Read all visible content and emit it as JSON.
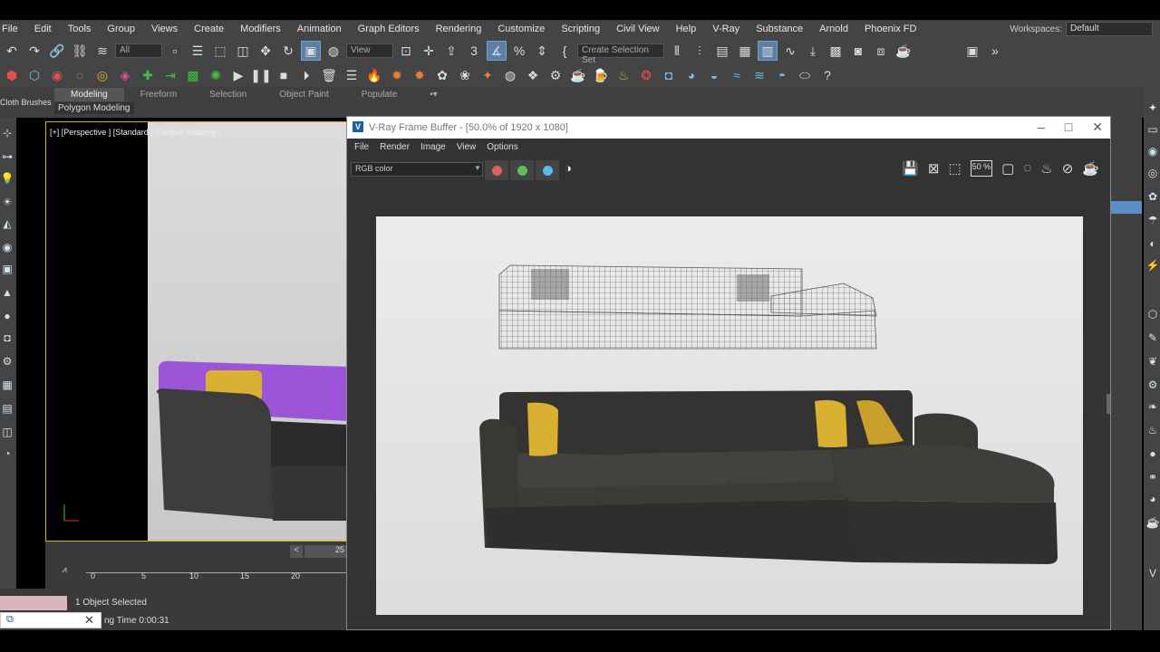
{
  "menubar": {
    "items": [
      "File",
      "Edit",
      "Tools",
      "Group",
      "Views",
      "Create",
      "Modifiers",
      "Animation",
      "Graph Editors",
      "Rendering",
      "Customize",
      "Scripting",
      "Civil View",
      "Help",
      "V-Ray",
      "Substance",
      "Arnold",
      "Phoenix FD"
    ],
    "workspaces_label": "Workspaces:",
    "workspace_value": "Default"
  },
  "toolbar": {
    "selection_filter": "All",
    "reference_coord": "View",
    "selection_set_placeholder": "Create Selection Set"
  },
  "ribbon": {
    "cloth_brushes": "Cloth Brushes",
    "tabs": [
      "Modeling",
      "Freeform",
      "Selection",
      "Object Paint",
      "Populate"
    ],
    "active_tab": "Modeling",
    "sub_label": "Polygon Modeling"
  },
  "viewport": {
    "label": "[+] [Perspective ] [Standard ] [Default Shading ]"
  },
  "timeline": {
    "frame": "25",
    "ticks": [
      "0",
      "5",
      "10",
      "15",
      "20"
    ]
  },
  "status": {
    "selected": "1 Object Selected",
    "time": "ng Time  0:00:31"
  },
  "vfb": {
    "title": "V-Ray Frame Buffer - [50.0% of 1920 x 1080]",
    "menu": [
      "File",
      "Render",
      "Image",
      "View",
      "Options"
    ],
    "channel": "RGB color",
    "zoom": "50 %"
  },
  "colors": {
    "accent_blue": "#5a8ec7",
    "viewport_border": "#d4b400",
    "red_channel": "#e06060",
    "green_channel": "#5cc05c",
    "blue_channel": "#5cb8e6",
    "pillow_yellow": "#d9b032",
    "sofa_dark": "#3a3835"
  }
}
